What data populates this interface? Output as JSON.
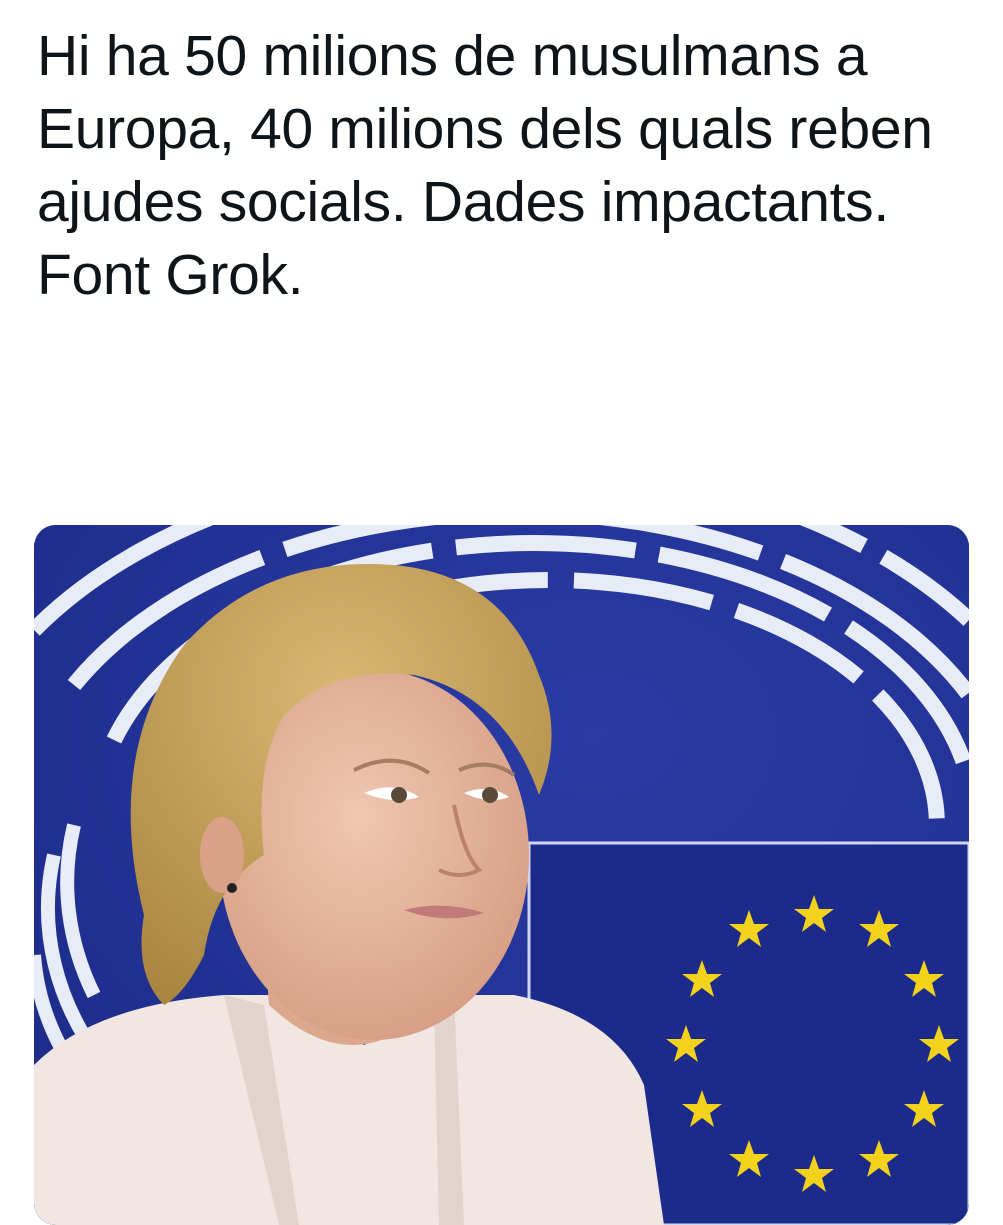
{
  "post": {
    "text": "Hi ha 50 milions de musulmans a Europa, 40 milions dels quals reben ajudes socials. Dades impactants. Font Grok."
  },
  "media": {
    "alt": "photo",
    "colors": {
      "background_blue": "#24349a",
      "stripe": "#e8ecf6",
      "flag_blue": "#1c2a8a",
      "star": "#f2d21b",
      "hair": "#c9a55e",
      "skin": "#e9b9a0",
      "jacket": "#f1e6e1"
    },
    "icons": [
      "eu-flag-star-icon"
    ]
  }
}
